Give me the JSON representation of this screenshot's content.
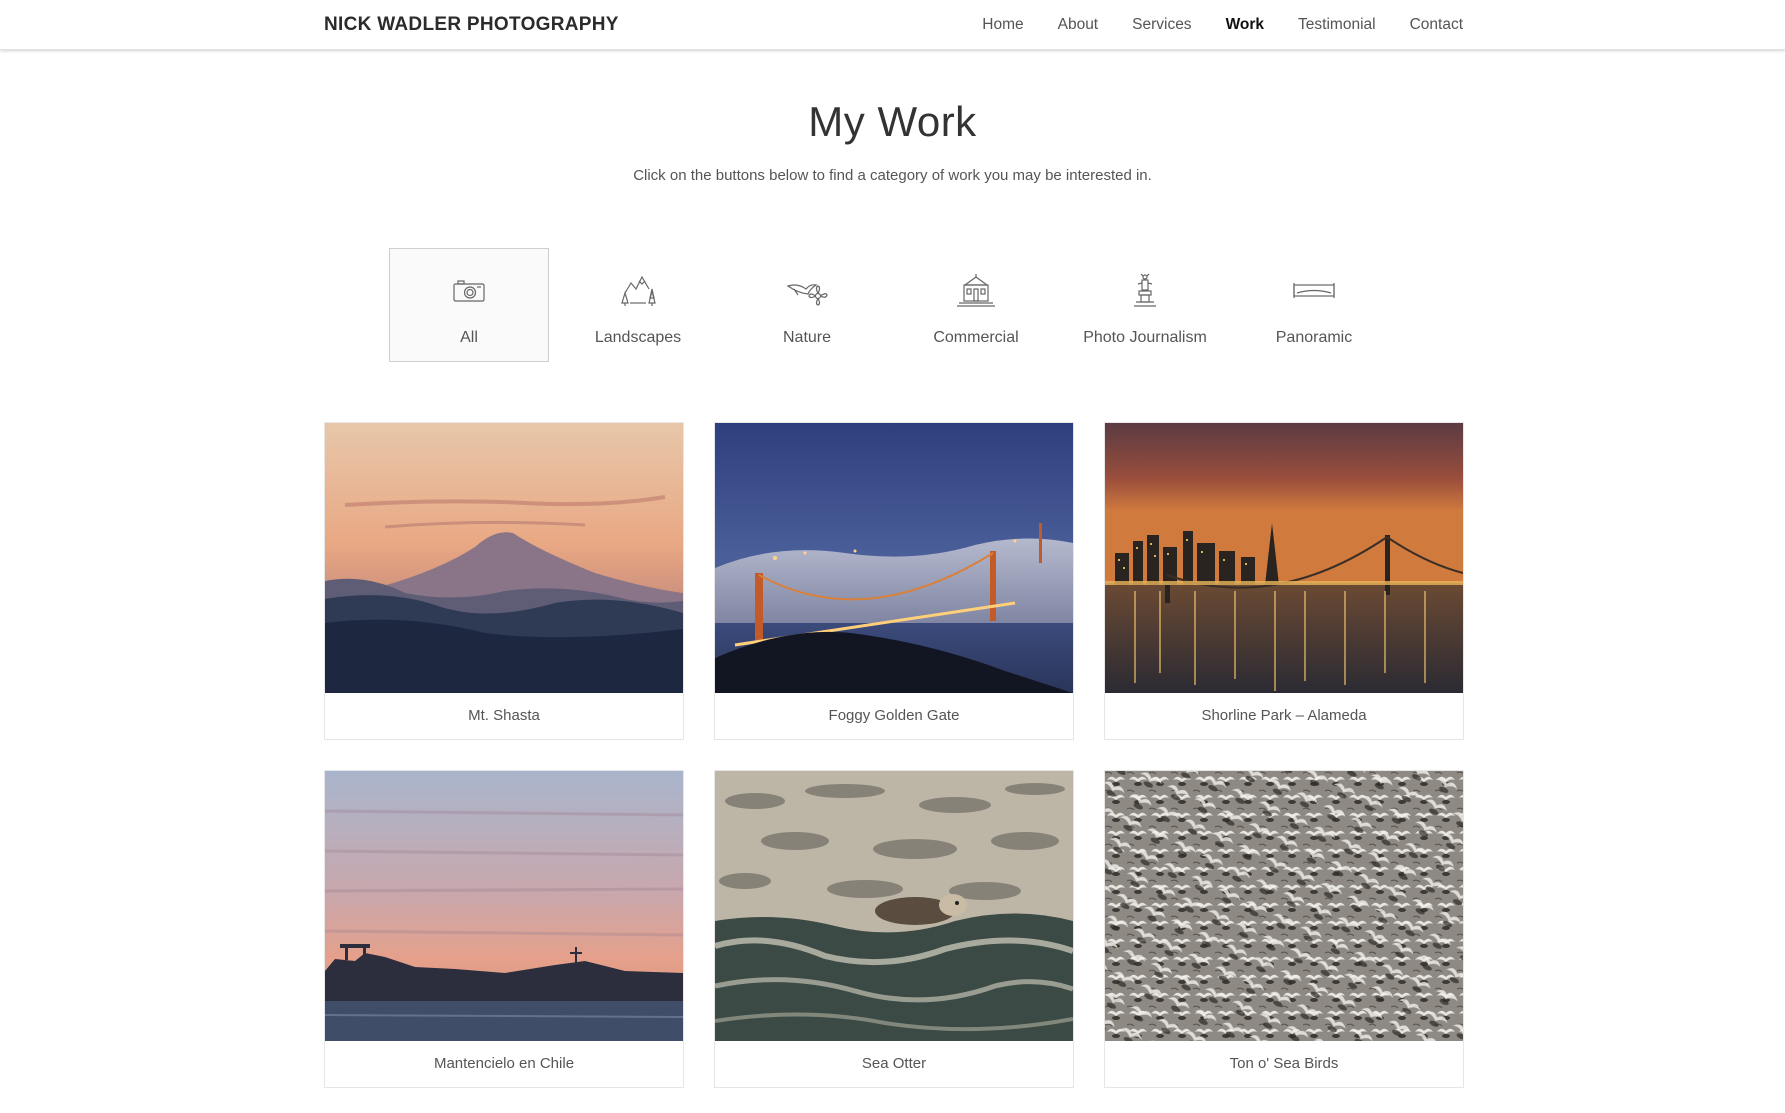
{
  "brand": "NICK WADLER PHOTOGRAPHY",
  "nav": [
    {
      "label": "Home",
      "active": false
    },
    {
      "label": "About",
      "active": false
    },
    {
      "label": "Services",
      "active": false
    },
    {
      "label": "Work",
      "active": true
    },
    {
      "label": "Testimonial",
      "active": false
    },
    {
      "label": "Contact",
      "active": false
    }
  ],
  "page": {
    "title": "My Work",
    "subtitle": "Click on the buttons below to find a category of work you may be interested in."
  },
  "filters": [
    {
      "label": "All",
      "icon": "camera-icon",
      "active": true
    },
    {
      "label": "Landscapes",
      "icon": "mountains-trees-icon",
      "active": false
    },
    {
      "label": "Nature",
      "icon": "bird-flower-icon",
      "active": false
    },
    {
      "label": "Commercial",
      "icon": "building-icon",
      "active": false
    },
    {
      "label": "Photo Journalism",
      "icon": "statue-icon",
      "active": false
    },
    {
      "label": "Panoramic",
      "icon": "panorama-frame-icon",
      "active": false
    }
  ],
  "gallery": [
    {
      "caption": "Mt. Shasta"
    },
    {
      "caption": "Foggy Golden Gate"
    },
    {
      "caption": "Shorline Park – Alameda"
    },
    {
      "caption": "Mantencielo en Chile"
    },
    {
      "caption": "Sea Otter"
    },
    {
      "caption": "Ton o' Sea Birds"
    }
  ],
  "colors": {
    "nav_active": "#111111",
    "text": "#555555",
    "brand": "#2b2b2b",
    "border": "#e6e6e6"
  }
}
